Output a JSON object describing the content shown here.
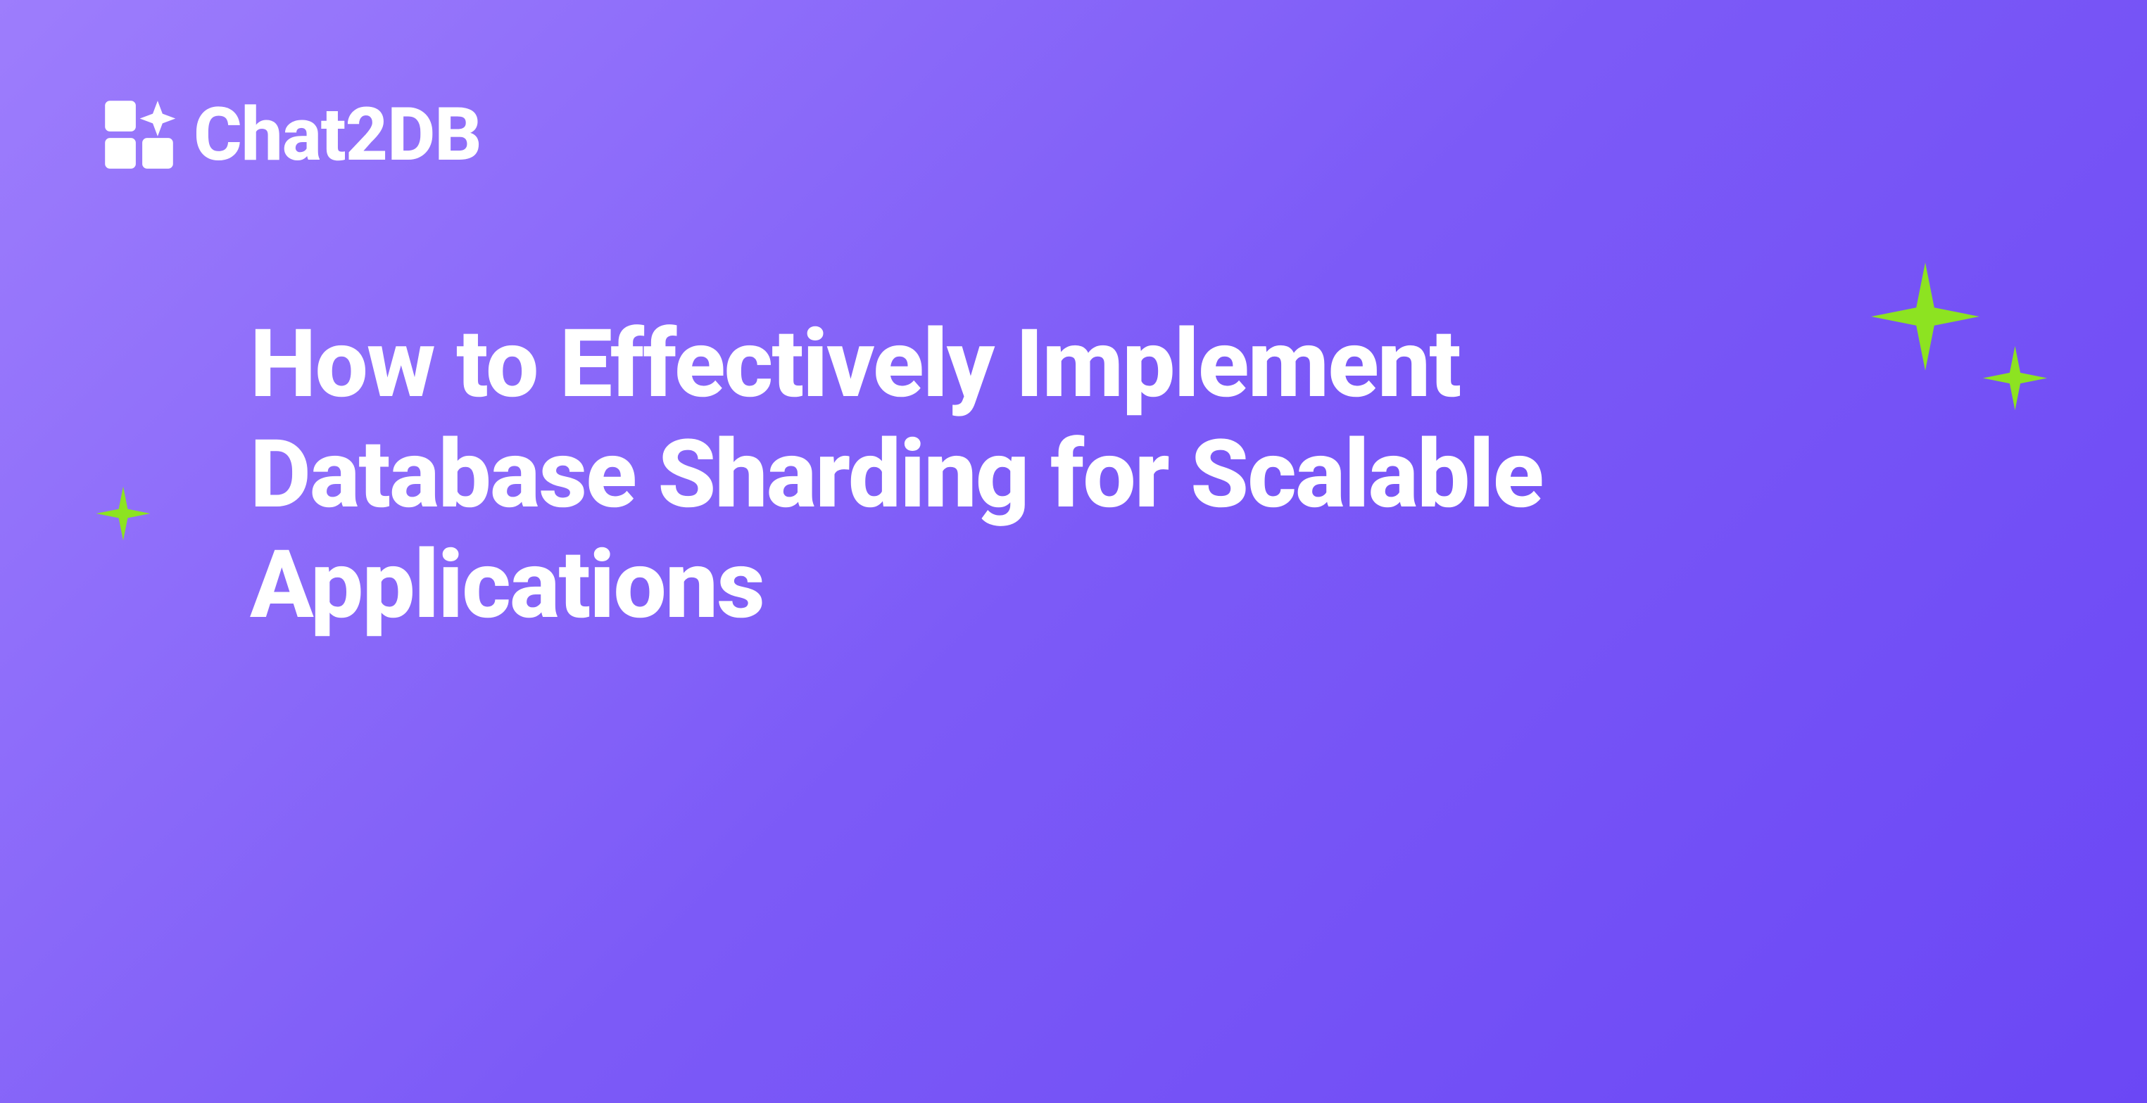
{
  "logo": {
    "text": "Chat2DB"
  },
  "headline": "How to Effectively Implement Database Sharding for Scalable Applications",
  "colors": {
    "background_start": "#9d7dfc",
    "background_end": "#6b47f5",
    "accent": "#8de321",
    "text": "#ffffff"
  }
}
